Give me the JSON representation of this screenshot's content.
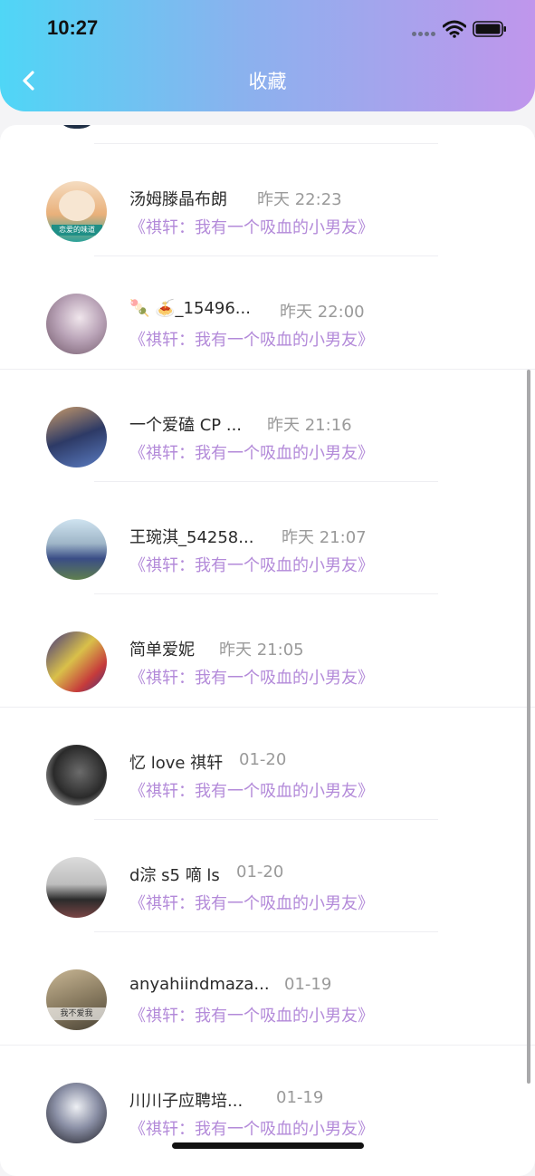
{
  "status_bar": {
    "time": "10:27"
  },
  "header": {
    "title": "收藏"
  },
  "items": [
    {
      "name": "汤姆滕晶布朗",
      "time": "昨天 22:23",
      "work": "《祺轩：我有一个吸血的小男友》",
      "avatar_colors": [
        "#f3d8b8",
        "#e7a86c",
        "#2aa198"
      ],
      "avatar_text": "恋爱的味道"
    },
    {
      "name": "🍡 🍝_15496...",
      "time": "昨天 22:00",
      "work": "《祺轩：我有一个吸血的小男友》",
      "avatar_colors": [
        "#d9ccd4",
        "#6e5566",
        "#b9a3b7"
      ]
    },
    {
      "name": "一个爱磕 CP ...",
      "time": "昨天 21:16",
      "work": "《祺轩：我有一个吸血的小男友》",
      "avatar_colors": [
        "#c89a6a",
        "#2d3a66",
        "#5a7cc2"
      ]
    },
    {
      "name": "王琬淇_54258...",
      "time": "昨天 21:07",
      "work": "《祺轩：我有一个吸血的小男友》",
      "avatar_colors": [
        "#cfe3f0",
        "#5f7f4e",
        "#3a4d86"
      ]
    },
    {
      "name": "简单爱妮",
      "time": "昨天 21:05",
      "work": "《祺轩：我有一个吸血的小男友》",
      "avatar_colors": [
        "#3f3380",
        "#d9c04a",
        "#c63b3b"
      ]
    },
    {
      "name": "忆 love 祺轩",
      "time": "01-20",
      "work": "《祺轩：我有一个吸血的小男友》",
      "avatar_colors": [
        "#e6e6e6",
        "#2a2a2a",
        "#6b6b6b"
      ]
    },
    {
      "name": "d淙 s5 嘀 ls",
      "time": "01-20",
      "work": "《祺轩：我有一个吸血的小男友》",
      "avatar_colors": [
        "#dcdcdc",
        "#2b2b2b",
        "#7a4545"
      ]
    },
    {
      "name": "anyahiindmaza...",
      "time": "01-19",
      "work": "《祺轩：我有一个吸血的小男友》",
      "avatar_colors": [
        "#c8b694",
        "#4b4436",
        "#8b7d62"
      ],
      "avatar_text": "我不爱我"
    },
    {
      "name": "川川子应聘培...",
      "time": "01-19",
      "work": "《祺轩：我有一个吸血的小男友》",
      "avatar_colors": [
        "#eef0f4",
        "#1d1d24",
        "#8b90a6"
      ]
    }
  ]
}
